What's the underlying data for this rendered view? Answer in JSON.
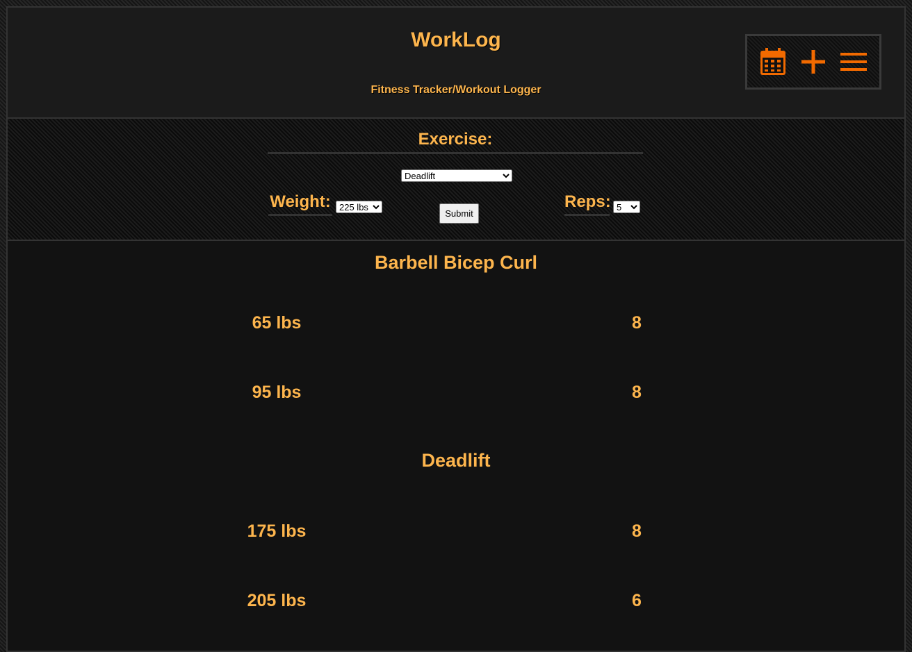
{
  "app": {
    "title": "WorkLog",
    "subtitle": "Fitness Tracker/Workout Logger"
  },
  "nav": {
    "icons": [
      "calendar-icon",
      "plus-icon",
      "menu-icon"
    ],
    "accent": "#f26a00"
  },
  "form": {
    "exercise_label": "Exercise:",
    "exercise_value": "Deadlift",
    "weight_label": "Weight:",
    "weight_value": "225 lbs",
    "reps_label": "Reps:",
    "reps_value": "5",
    "submit_label": "Submit"
  },
  "log": [
    {
      "exercise": "Barbell Bicep Curl",
      "sets": [
        {
          "weight": "65 lbs",
          "reps": "8"
        },
        {
          "weight": "95 lbs",
          "reps": "8"
        }
      ]
    },
    {
      "exercise": "Deadlift",
      "sets": [
        {
          "weight": "175 lbs",
          "reps": "8"
        },
        {
          "weight": "205 lbs",
          "reps": "6"
        }
      ]
    }
  ],
  "colors": {
    "text_accent": "#fdb54d",
    "icon_accent": "#f26a00",
    "background": "#121212"
  }
}
